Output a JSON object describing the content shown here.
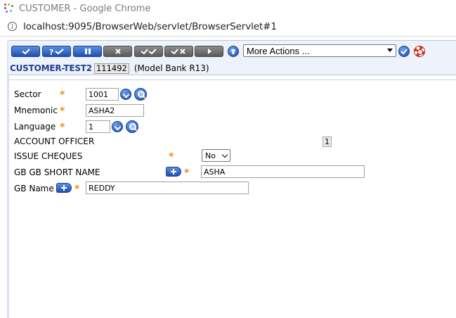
{
  "window": {
    "title": "CUSTOMER - Google Chrome",
    "url": "localhost:9095/BrowserWeb/servlet/BrowserServlet#1"
  },
  "toolbar": {
    "buttons": [
      {
        "name": "commit-button",
        "icon": "check-icon"
      },
      {
        "name": "validate-button",
        "icon": "question-check-icon"
      },
      {
        "name": "hold-button",
        "icon": "pause-icon"
      },
      {
        "name": "delete-button",
        "icon": "cross-icon"
      },
      {
        "name": "authorise-button",
        "icon": "double-check-icon"
      },
      {
        "name": "reverse-button",
        "icon": "check-cross-icon"
      },
      {
        "name": "next-button",
        "icon": "play-icon"
      }
    ],
    "more_actions": "More Actions ...",
    "accent_color": "#1f4fb4",
    "disabled_color": "#5a5a5a"
  },
  "record": {
    "app": "CUSTOMER-TEST2",
    "id": "111492",
    "note": "(Model Bank R13)"
  },
  "form": {
    "sector": {
      "label": "Sector",
      "value": "1001"
    },
    "mnemonic": {
      "label": "Mnemonic",
      "value": "ASHA2"
    },
    "language": {
      "label": "Language",
      "value": "1"
    },
    "account_officer": {
      "label": "ACCOUNT OFFICER",
      "value": "1"
    },
    "issue_cheques": {
      "label": "ISSUE CHEQUES",
      "value": "No"
    },
    "gb_short_name": {
      "label": "GB GB SHORT NAME",
      "value": "ASHA"
    },
    "gb_name": {
      "label": "GB Name",
      "value": "REDDY"
    },
    "required_mark": "*",
    "required_color": "#f08c1e"
  }
}
